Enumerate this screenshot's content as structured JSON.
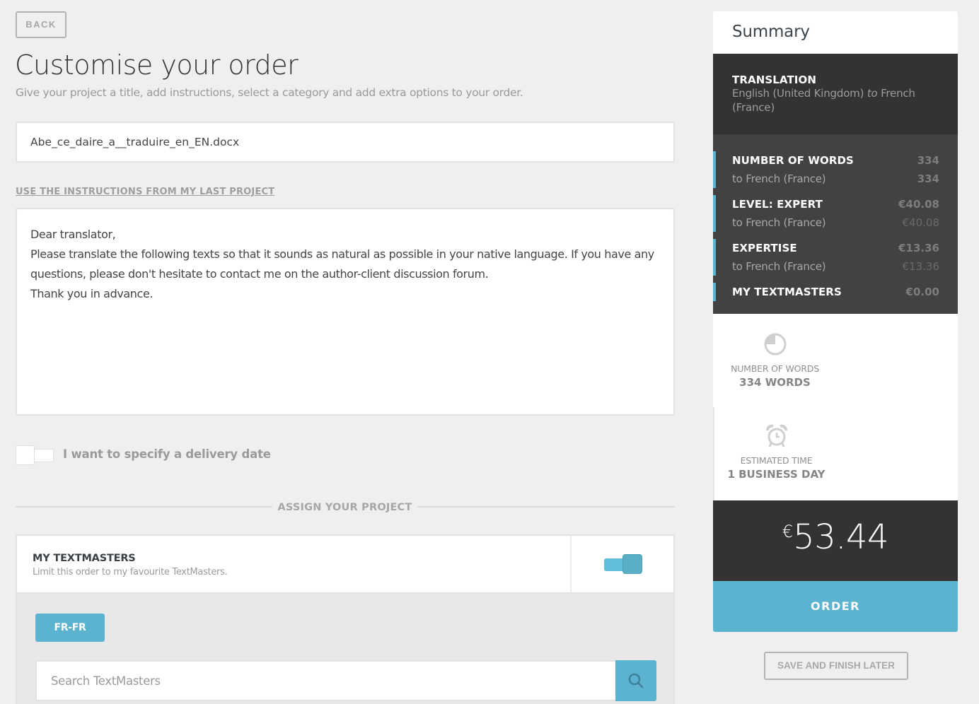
{
  "header": {
    "back_label": "BACK",
    "title": "Customise your order",
    "subtitle": "Give your project a title, add instructions, select a category and add extra options to your order."
  },
  "project": {
    "title_value": "Abe_ce_daire_a__traduire_en_EN.docx",
    "last_instructions_link": "USE THE INSTRUCTIONS FROM MY LAST PROJECT",
    "instructions_value": "Dear translator,\nPlease translate the following texts so that it sounds as natural as possible in your native language. If you have any questions, please don't hesitate to contact me on the author-client discussion forum.\nThank you in advance.",
    "delivery_date_label": "I want to specify a delivery date",
    "delivery_date_enabled": false
  },
  "assign": {
    "section_title": "ASSIGN YOUR PROJECT",
    "my_textmasters_title": "MY TEXTMASTERS",
    "my_textmasters_desc": "Limit this order to my favourite TextMasters.",
    "my_textmasters_enabled": true,
    "language_tag": "FR-FR",
    "search_placeholder": "Search TextMasters",
    "search_icon": "search-icon"
  },
  "summary": {
    "title": "Summary",
    "translation_title": "TRANSLATION",
    "translation_source": "English (United Kingdom)",
    "translation_connector": "to",
    "translation_target": "French (France)",
    "lines": [
      {
        "label": "NUMBER OF WORDS",
        "value": "334",
        "sub_label": "to French (France)",
        "sub_value": "334"
      },
      {
        "label": "LEVEL: EXPERT",
        "value": "€40.08",
        "sub_label": "to French (France)",
        "sub_value": "€40.08"
      },
      {
        "label": "EXPERTISE",
        "value": "€13.36",
        "sub_label": "to French (France)",
        "sub_value": "€13.36"
      },
      {
        "label": "MY TEXTMASTERS",
        "value": "€0.00"
      }
    ],
    "stats": {
      "words_label": "NUMBER OF WORDS",
      "words_value": "334 WORDS",
      "words_icon": "pie-chart-icon",
      "time_label": "ESTIMATED TIME",
      "time_value": "1 BUSINESS DAY",
      "time_icon": "alarm-clock-icon"
    },
    "total_currency": "€",
    "total_amount": "53.44",
    "order_label": "ORDER",
    "save_label": "SAVE AND FINISH LATER"
  },
  "colors": {
    "accent": "#5cb3cf",
    "dark_panel": "#333333",
    "lines_panel": "#424242",
    "page_bg": "#efefef"
  }
}
